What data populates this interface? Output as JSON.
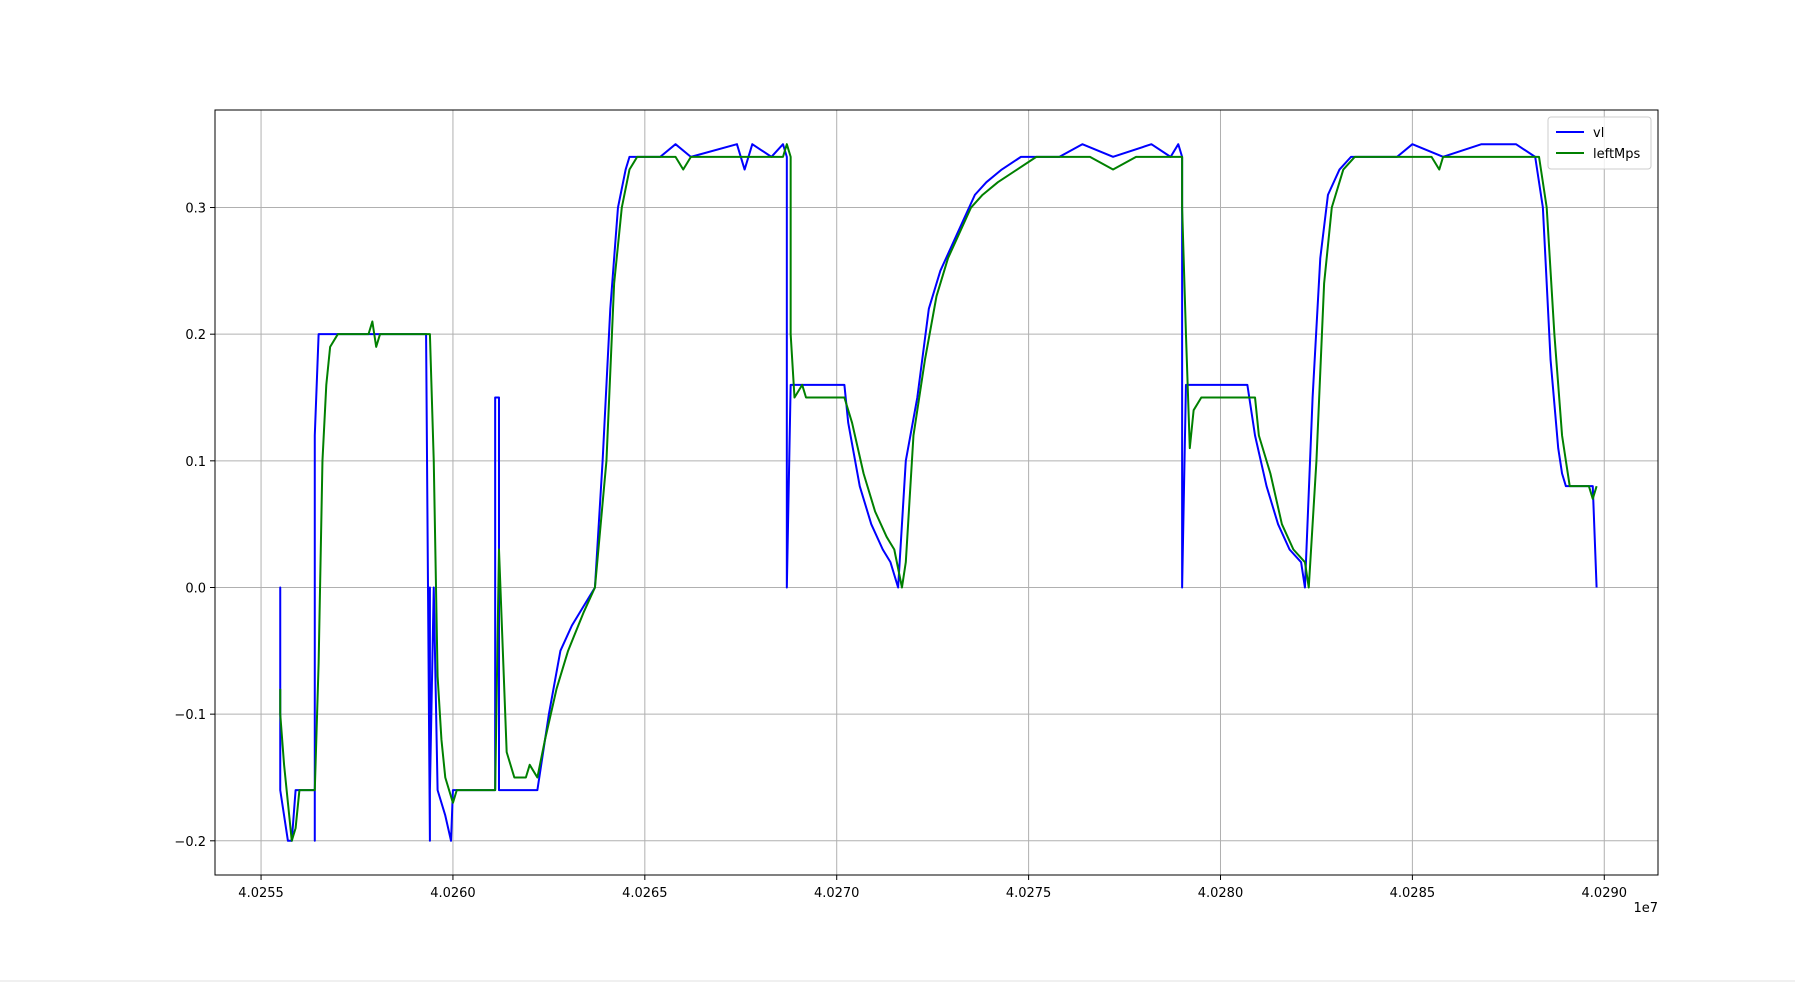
{
  "chart_data": {
    "type": "line",
    "title": "",
    "xlabel": "",
    "ylabel": "",
    "x_offset_text": "1e7",
    "xlim": [
      4.02538,
      4.02914
    ],
    "ylim": [
      -0.227,
      0.377
    ],
    "xticks": [
      4.0255,
      4.026,
      4.0265,
      4.027,
      4.0275,
      4.028,
      4.0285,
      4.029
    ],
    "xtick_labels": [
      "4.0255",
      "4.0260",
      "4.0265",
      "4.0270",
      "4.0275",
      "4.0280",
      "4.0285",
      "4.0290"
    ],
    "yticks": [
      -0.2,
      -0.1,
      0.0,
      0.1,
      0.2,
      0.3
    ],
    "ytick_labels": [
      "−0.2",
      "−0.1",
      "0.0",
      "0.1",
      "0.2",
      "0.3"
    ],
    "grid": true,
    "legend_position": "upper-right",
    "series": [
      {
        "name": "vl",
        "color": "#0000ff",
        "points": [
          [
            4.02555,
            -0.16
          ],
          [
            4.02555,
            0.0
          ],
          [
            4.02555,
            -0.16
          ],
          [
            4.02556,
            -0.18
          ],
          [
            4.02557,
            -0.2
          ],
          [
            4.02558,
            -0.2
          ],
          [
            4.02559,
            -0.16
          ],
          [
            4.02564,
            -0.16
          ],
          [
            4.02564,
            -0.2
          ],
          [
            4.02564,
            0.12
          ],
          [
            4.02565,
            0.2
          ],
          [
            4.02593,
            0.2
          ],
          [
            4.02594,
            -0.2
          ],
          [
            4.02594,
            0.0
          ],
          [
            4.02594,
            -0.16
          ],
          [
            4.02595,
            0.0
          ],
          [
            4.02596,
            -0.16
          ],
          [
            4.02598,
            -0.18
          ],
          [
            4.025995,
            -0.2
          ],
          [
            4.026,
            -0.16
          ],
          [
            4.02611,
            -0.16
          ],
          [
            4.02611,
            0.15
          ],
          [
            4.02612,
            0.15
          ],
          [
            4.02612,
            -0.16
          ],
          [
            4.02622,
            -0.16
          ],
          [
            4.02625,
            -0.1
          ],
          [
            4.02628,
            -0.05
          ],
          [
            4.02631,
            -0.03
          ],
          [
            4.02637,
            0.0
          ],
          [
            4.02639,
            0.1
          ],
          [
            4.02641,
            0.22
          ],
          [
            4.02643,
            0.3
          ],
          [
            4.02645,
            0.33
          ],
          [
            4.02646,
            0.34
          ],
          [
            4.02654,
            0.34
          ],
          [
            4.02658,
            0.35
          ],
          [
            4.02662,
            0.34
          ],
          [
            4.02674,
            0.35
          ],
          [
            4.02676,
            0.33
          ],
          [
            4.02678,
            0.35
          ],
          [
            4.02683,
            0.34
          ],
          [
            4.02686,
            0.35
          ],
          [
            4.02687,
            0.34
          ],
          [
            4.02687,
            0.0
          ],
          [
            4.02688,
            0.16
          ],
          [
            4.02702,
            0.16
          ],
          [
            4.02703,
            0.13
          ],
          [
            4.02706,
            0.08
          ],
          [
            4.02709,
            0.05
          ],
          [
            4.02712,
            0.03
          ],
          [
            4.02714,
            0.02
          ],
          [
            4.02716,
            0.0
          ],
          [
            4.02718,
            0.1
          ],
          [
            4.02721,
            0.15
          ],
          [
            4.02724,
            0.22
          ],
          [
            4.02727,
            0.25
          ],
          [
            4.0273,
            0.27
          ],
          [
            4.02733,
            0.29
          ],
          [
            4.02736,
            0.31
          ],
          [
            4.02739,
            0.32
          ],
          [
            4.02743,
            0.33
          ],
          [
            4.02748,
            0.34
          ],
          [
            4.02758,
            0.34
          ],
          [
            4.02764,
            0.35
          ],
          [
            4.02772,
            0.34
          ],
          [
            4.02782,
            0.35
          ],
          [
            4.02787,
            0.34
          ],
          [
            4.02789,
            0.35
          ],
          [
            4.0279,
            0.34
          ],
          [
            4.0279,
            0.0
          ],
          [
            4.02791,
            0.16
          ],
          [
            4.02807,
            0.16
          ],
          [
            4.02809,
            0.12
          ],
          [
            4.02812,
            0.08
          ],
          [
            4.02815,
            0.05
          ],
          [
            4.02818,
            0.03
          ],
          [
            4.02821,
            0.02
          ],
          [
            4.02822,
            0.0
          ],
          [
            4.02824,
            0.15
          ],
          [
            4.02826,
            0.26
          ],
          [
            4.02828,
            0.31
          ],
          [
            4.02831,
            0.33
          ],
          [
            4.02834,
            0.34
          ],
          [
            4.02846,
            0.34
          ],
          [
            4.0285,
            0.35
          ],
          [
            4.02858,
            0.34
          ],
          [
            4.02868,
            0.35
          ],
          [
            4.02877,
            0.35
          ],
          [
            4.02882,
            0.34
          ],
          [
            4.02884,
            0.3
          ],
          [
            4.02886,
            0.18
          ],
          [
            4.02888,
            0.11
          ],
          [
            4.02889,
            0.09
          ],
          [
            4.0289,
            0.08
          ],
          [
            4.02897,
            0.08
          ],
          [
            4.02898,
            0.0
          ]
        ]
      },
      {
        "name": "leftMps",
        "color": "#008000",
        "points": [
          [
            4.02555,
            -0.08
          ],
          [
            4.02555,
            -0.1
          ],
          [
            4.02556,
            -0.14
          ],
          [
            4.02557,
            -0.17
          ],
          [
            4.02558,
            -0.2
          ],
          [
            4.02559,
            -0.19
          ],
          [
            4.0256,
            -0.16
          ],
          [
            4.02564,
            -0.16
          ],
          [
            4.02565,
            -0.06
          ],
          [
            4.02566,
            0.1
          ],
          [
            4.02567,
            0.16
          ],
          [
            4.02568,
            0.19
          ],
          [
            4.0257,
            0.2
          ],
          [
            4.02578,
            0.2
          ],
          [
            4.02579,
            0.21
          ],
          [
            4.0258,
            0.19
          ],
          [
            4.02581,
            0.2
          ],
          [
            4.02594,
            0.2
          ],
          [
            4.02595,
            0.1
          ],
          [
            4.02596,
            -0.07
          ],
          [
            4.02597,
            -0.12
          ],
          [
            4.02598,
            -0.15
          ],
          [
            4.026,
            -0.17
          ],
          [
            4.02601,
            -0.16
          ],
          [
            4.02611,
            -0.16
          ],
          [
            4.02612,
            0.03
          ],
          [
            4.02613,
            -0.05
          ],
          [
            4.02614,
            -0.13
          ],
          [
            4.02616,
            -0.15
          ],
          [
            4.02619,
            -0.15
          ],
          [
            4.0262,
            -0.14
          ],
          [
            4.02622,
            -0.15
          ],
          [
            4.02624,
            -0.12
          ],
          [
            4.02627,
            -0.08
          ],
          [
            4.0263,
            -0.05
          ],
          [
            4.02634,
            -0.02
          ],
          [
            4.02637,
            0.0
          ],
          [
            4.0264,
            0.1
          ],
          [
            4.02642,
            0.24
          ],
          [
            4.02644,
            0.3
          ],
          [
            4.02646,
            0.33
          ],
          [
            4.02648,
            0.34
          ],
          [
            4.02658,
            0.34
          ],
          [
            4.0266,
            0.33
          ],
          [
            4.02662,
            0.34
          ],
          [
            4.02686,
            0.34
          ],
          [
            4.02687,
            0.35
          ],
          [
            4.02688,
            0.34
          ],
          [
            4.02688,
            0.2
          ],
          [
            4.02689,
            0.15
          ],
          [
            4.02691,
            0.16
          ],
          [
            4.02692,
            0.15
          ],
          [
            4.02702,
            0.15
          ],
          [
            4.02704,
            0.13
          ],
          [
            4.02707,
            0.09
          ],
          [
            4.0271,
            0.06
          ],
          [
            4.02713,
            0.04
          ],
          [
            4.02715,
            0.03
          ],
          [
            4.02717,
            0.0
          ],
          [
            4.02718,
            0.02
          ],
          [
            4.0272,
            0.12
          ],
          [
            4.02723,
            0.18
          ],
          [
            4.02726,
            0.23
          ],
          [
            4.02729,
            0.26
          ],
          [
            4.02732,
            0.28
          ],
          [
            4.02735,
            0.3
          ],
          [
            4.02738,
            0.31
          ],
          [
            4.02742,
            0.32
          ],
          [
            4.02747,
            0.33
          ],
          [
            4.02752,
            0.34
          ],
          [
            4.02766,
            0.34
          ],
          [
            4.02772,
            0.33
          ],
          [
            4.02778,
            0.34
          ],
          [
            4.0279,
            0.34
          ],
          [
            4.0279,
            0.3
          ],
          [
            4.02791,
            0.2
          ],
          [
            4.02792,
            0.11
          ],
          [
            4.02793,
            0.14
          ],
          [
            4.02795,
            0.15
          ],
          [
            4.02809,
            0.15
          ],
          [
            4.0281,
            0.12
          ],
          [
            4.02813,
            0.09
          ],
          [
            4.02816,
            0.05
          ],
          [
            4.02819,
            0.03
          ],
          [
            4.02822,
            0.02
          ],
          [
            4.02823,
            0.0
          ],
          [
            4.02825,
            0.1
          ],
          [
            4.02827,
            0.24
          ],
          [
            4.02829,
            0.3
          ],
          [
            4.02832,
            0.33
          ],
          [
            4.02835,
            0.34
          ],
          [
            4.02855,
            0.34
          ],
          [
            4.02857,
            0.33
          ],
          [
            4.02858,
            0.34
          ],
          [
            4.0288,
            0.34
          ],
          [
            4.02883,
            0.34
          ],
          [
            4.02885,
            0.3
          ],
          [
            4.02887,
            0.2
          ],
          [
            4.02889,
            0.12
          ],
          [
            4.0289,
            0.1
          ],
          [
            4.02891,
            0.08
          ],
          [
            4.02896,
            0.08
          ],
          [
            4.02897,
            0.07
          ],
          [
            4.02898,
            0.08
          ]
        ]
      }
    ]
  }
}
